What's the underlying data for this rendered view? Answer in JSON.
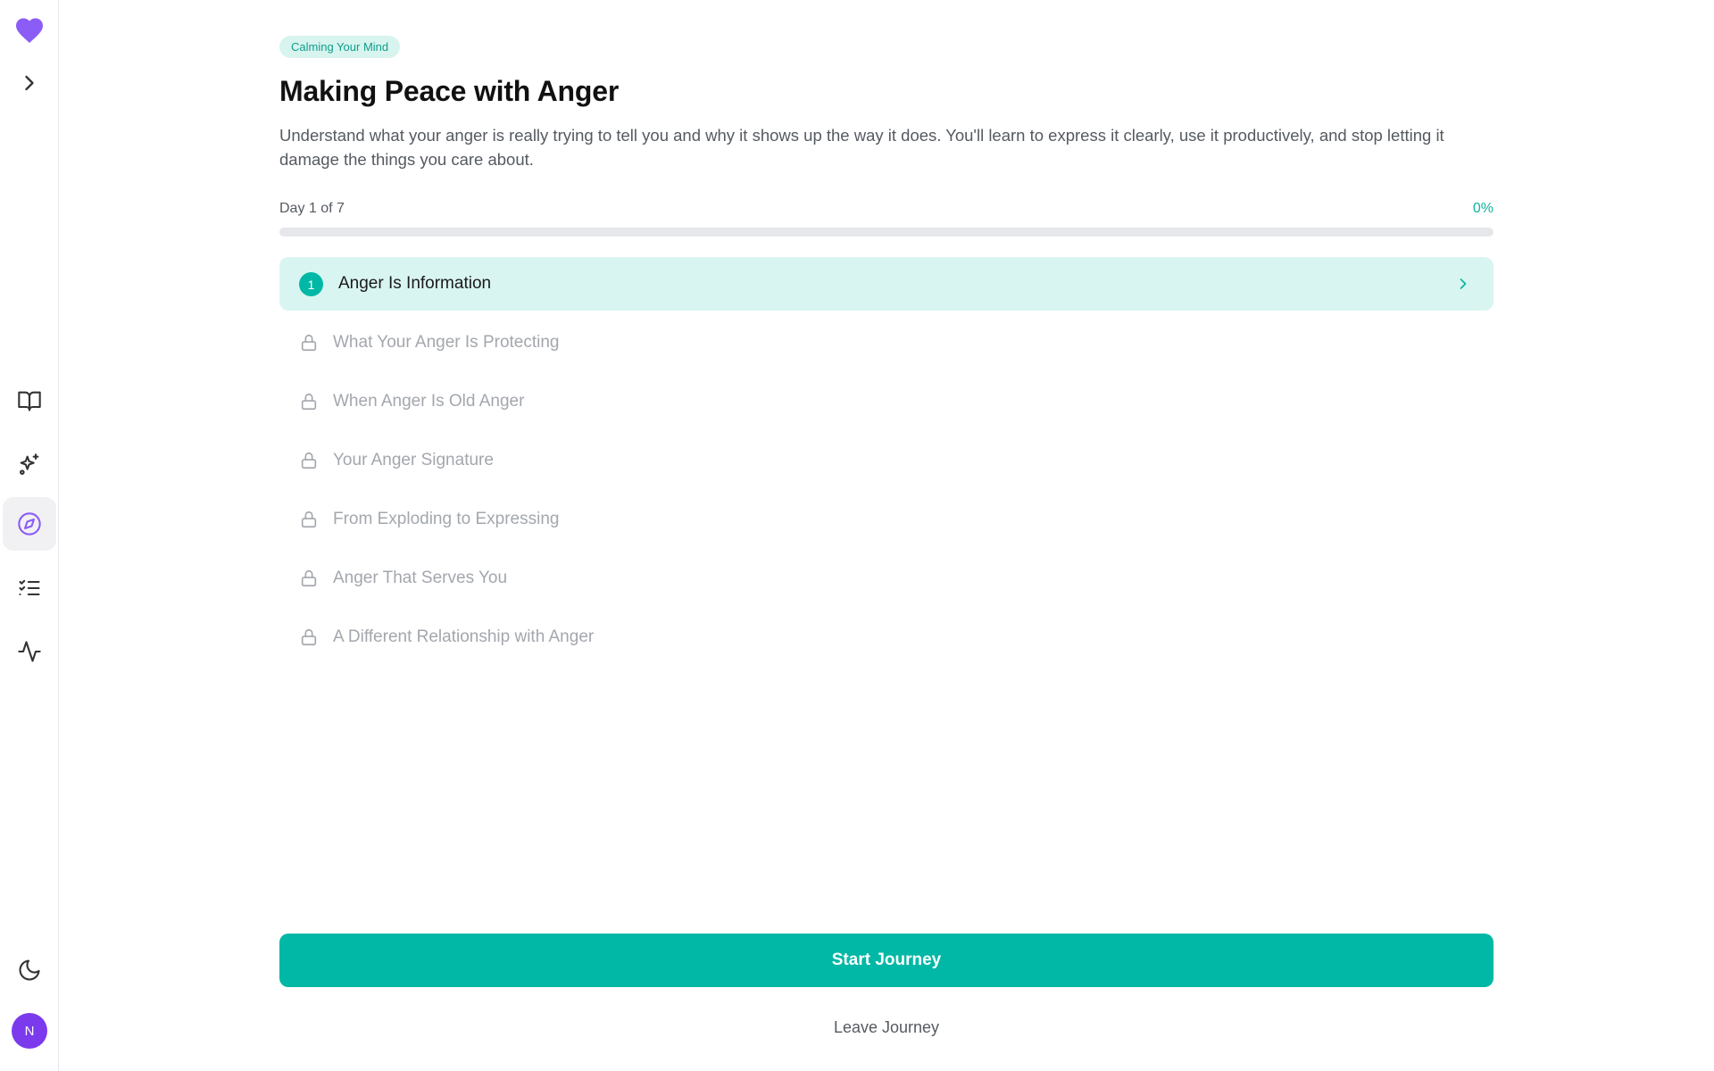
{
  "colors": {
    "accent": "#00b8a5",
    "brand": "#8b5cf6",
    "badge_bg": "#d8f4ef",
    "current_row_bg": "#d9f5f1"
  },
  "sidebar": {
    "logo_icon": "heart-icon",
    "expand_icon": "chevron-right-icon",
    "nav": [
      {
        "icon": "book-open-icon",
        "active": false
      },
      {
        "icon": "sparkles-icon",
        "active": false
      },
      {
        "icon": "compass-icon",
        "active": true
      },
      {
        "icon": "list-checks-icon",
        "active": false
      },
      {
        "icon": "activity-icon",
        "active": false
      }
    ],
    "theme_icon": "moon-icon",
    "avatar_initial": "N"
  },
  "journey": {
    "category": "Calming Your Mind",
    "title": "Making Peace with Anger",
    "description": "Understand what your anger is really trying to tell you and why it shows up the way it does. You'll learn to express it clearly, use it productively, and stop letting it damage the things you care about.",
    "progress_label": "Day 1 of 7",
    "progress_percent_label": "0%",
    "progress_fraction": 0,
    "days": [
      {
        "number": "1",
        "title": "Anger Is Information",
        "state": "current"
      },
      {
        "title": "What Your Anger Is Protecting",
        "state": "locked"
      },
      {
        "title": "When Anger Is Old Anger",
        "state": "locked"
      },
      {
        "title": "Your Anger Signature",
        "state": "locked"
      },
      {
        "title": "From Exploding to Expressing",
        "state": "locked"
      },
      {
        "title": "Anger That Serves You",
        "state": "locked"
      },
      {
        "title": "A Different Relationship with Anger",
        "state": "locked"
      }
    ],
    "start_label": "Start Journey",
    "leave_label": "Leave Journey"
  }
}
